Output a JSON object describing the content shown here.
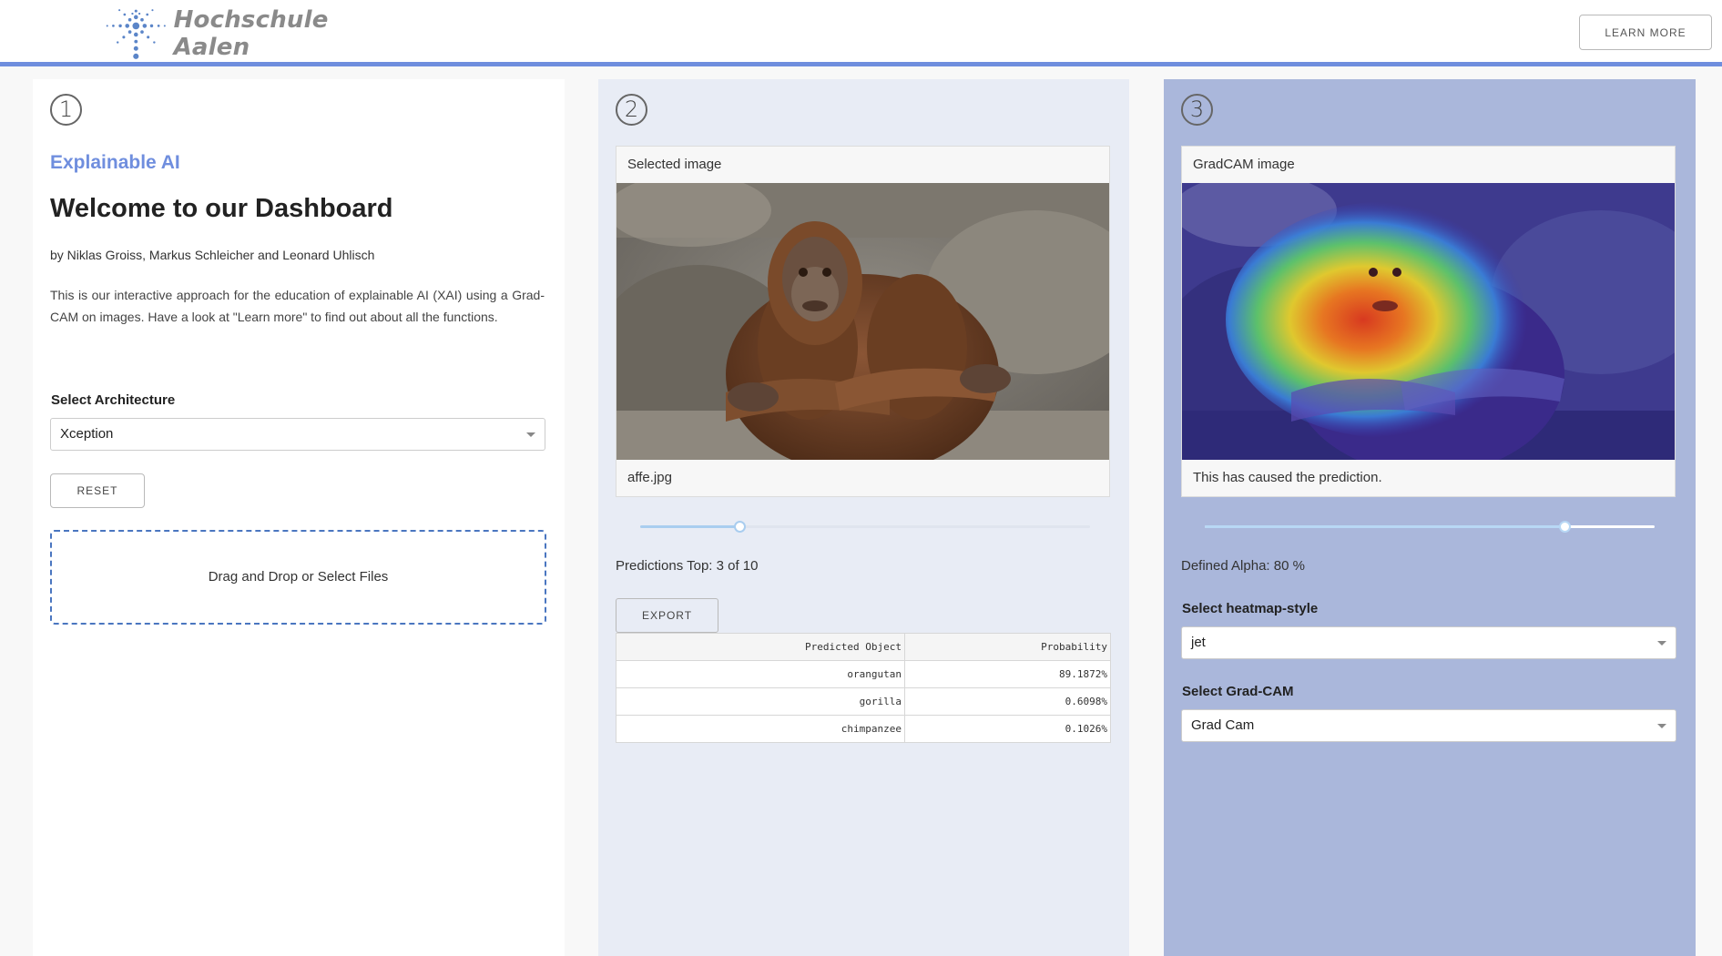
{
  "header": {
    "logo_text": "Hochschule Aalen",
    "learn_more_label": "LEARN MORE"
  },
  "colors": {
    "accent": "#6f8ede",
    "col2_bg": "#e8ecf5",
    "col3_bg": "#aab7db",
    "dropzone_border": "#4a76c0"
  },
  "col1": {
    "step": "1",
    "subtitle": "Explainable AI",
    "title": "Welcome to our Dashboard",
    "authors": "by Niklas Groiss, Markus Schleicher and Leonard Uhlisch",
    "intro": "This is our interactive approach for the education of explainable AI (XAI) using a Grad-CAM on images. Have a look at \"Learn more\" to find out about all the functions.",
    "architecture_label": "Select Architecture",
    "architecture_value": "Xception",
    "reset_label": "RESET",
    "dropzone_text": "Drag and Drop or Select Files"
  },
  "col2": {
    "step": "2",
    "card_title": "Selected image",
    "card_caption": "affe.jpg",
    "top_n_slider_fraction": 0.22,
    "predictions_text": "Predictions Top: 3 of 10",
    "export_label": "EXPORT",
    "table": {
      "headers": [
        "Predicted Object",
        "Probability"
      ],
      "rows": [
        [
          "orangutan",
          "89.1872%"
        ],
        [
          "gorilla",
          "0.6098%"
        ],
        [
          "chimpanzee",
          "0.1026%"
        ]
      ]
    }
  },
  "col3": {
    "step": "3",
    "card_title": "GradCAM image",
    "card_caption": "This has caused the prediction.",
    "alpha_slider_fraction": 0.8,
    "alpha_text": "Defined Alpha: 80 %",
    "heatmap_label": "Select heatmap-style",
    "heatmap_value": "jet",
    "gradcam_label": "Select Grad-CAM",
    "gradcam_value": "Grad Cam"
  },
  "icons": {
    "logo": "starburst-logo-icon",
    "dropdown": "chevron-down-icon"
  }
}
